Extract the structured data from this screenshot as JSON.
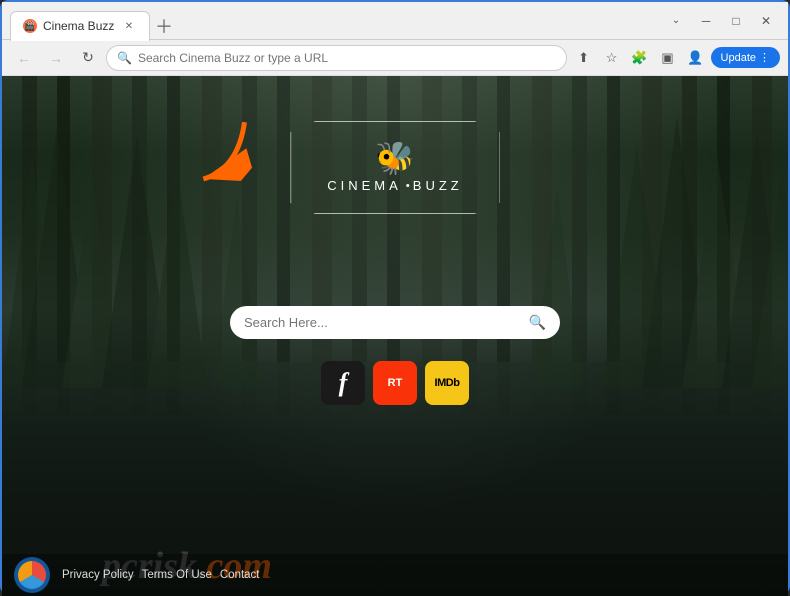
{
  "browser": {
    "tab": {
      "title": "Cinema Buzz",
      "favicon_label": "CB"
    },
    "address_bar": {
      "placeholder": "Search Cinema Buzz or type a URL"
    },
    "buttons": {
      "back": "←",
      "forward": "→",
      "refresh": "↻",
      "update_label": "Update"
    }
  },
  "page": {
    "logo": {
      "bee_symbol": "🐝",
      "title_left": "CINEMA",
      "dot": "·",
      "title_right": "BUZZ"
    },
    "search": {
      "placeholder": "Search Here...",
      "search_icon": "🔍"
    },
    "site_icons": [
      {
        "name": "Fandango",
        "label": "𝐟",
        "style": "fandango"
      },
      {
        "name": "Rotten Tomatoes",
        "label": "RT",
        "style": "rt"
      },
      {
        "name": "IMDb",
        "label": "IMDb",
        "style": "imdb"
      }
    ],
    "footer": {
      "links": [
        "Privacy Policy",
        "Terms Of Use",
        "Contact"
      ]
    }
  },
  "watermark": {
    "text_gray": "pcrisk",
    "dot": ".",
    "text_orange": "com"
  }
}
